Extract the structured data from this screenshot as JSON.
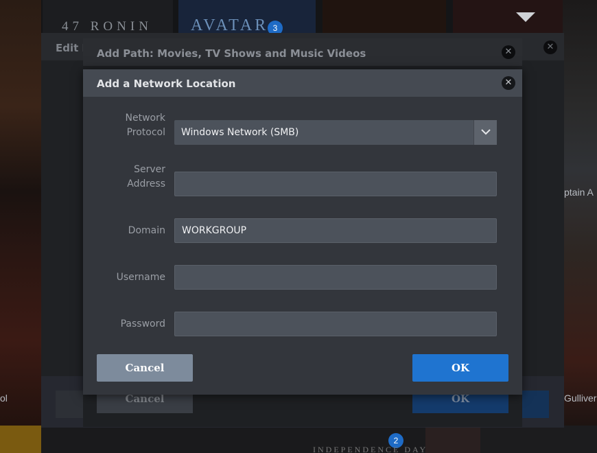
{
  "background": {
    "poster_title_1": "47 RONIN",
    "poster_title_2": "AVATAR",
    "badge_1": "3",
    "badge_2": "2",
    "side_text_left": "ol",
    "side_text_right_1": "ptain A",
    "side_text_right_2": "Gulliver",
    "bottom_poster_text": "INDEPENDENCE DAY"
  },
  "edit_library_dialog": {
    "title": "Edit L",
    "close_glyph": "✕"
  },
  "add_path_dialog": {
    "title": "Add Path: Movies, TV Shows and Music Videos",
    "close_glyph": "✕",
    "cancel_label": "Cancel",
    "ok_label": "OK"
  },
  "network_dialog": {
    "title": "Add a Network Location",
    "close_glyph": "✕",
    "protocol": {
      "label_line1": "Network",
      "label_line2": "Protocol",
      "selected": "Windows Network (SMB)"
    },
    "server": {
      "label_line1": "Server",
      "label_line2": "Address",
      "value": ""
    },
    "domain": {
      "label": "Domain",
      "value": "WORKGROUP"
    },
    "username": {
      "label": "Username",
      "value": ""
    },
    "password": {
      "label": "Password",
      "value": ""
    },
    "cancel_label": "Cancel",
    "ok_label": "OK"
  },
  "colors": {
    "accent": "#1f74d0",
    "cancel_button": "#7d8b9c",
    "dialog": "#33363c",
    "header": "#454a52"
  }
}
